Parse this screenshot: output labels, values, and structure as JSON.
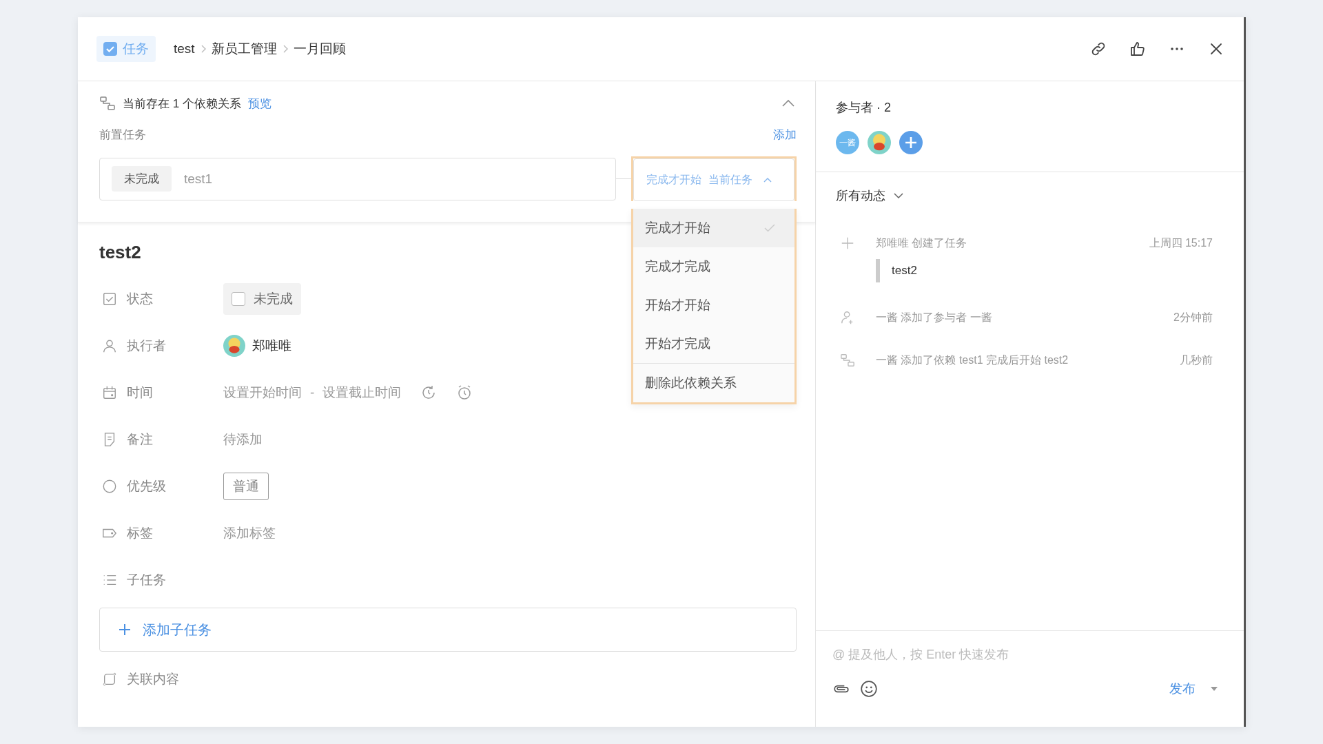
{
  "header": {
    "type_badge": {
      "label": "任务",
      "checked": true
    },
    "breadcrumb": [
      "test",
      "新员工管理",
      "一月回顾"
    ]
  },
  "dependency": {
    "summary": "当前存在 1 个依赖关系",
    "preview_link": "预览",
    "expanded": true,
    "section_label": "前置任务",
    "add_link": "添加",
    "item": {
      "status": "未完成",
      "task": "test1",
      "relation": "完成才开始",
      "target": "当前任务"
    }
  },
  "dropdown": {
    "options": [
      {
        "label": "完成才开始",
        "selected": true
      },
      {
        "label": "完成才完成",
        "selected": false
      },
      {
        "label": "开始才开始",
        "selected": false
      },
      {
        "label": "开始才完成",
        "selected": false
      }
    ],
    "delete_label": "删除此依赖关系"
  },
  "task": {
    "title": "test2",
    "fields": [
      {
        "kind": "status",
        "label": "状态",
        "value": "未完成",
        "checked": false
      },
      {
        "kind": "assignee",
        "label": "执行者",
        "value": "郑唯唯"
      },
      {
        "kind": "time",
        "label": "时间",
        "start": "设置开始时间",
        "separator": "-",
        "end": "设置截止时间"
      },
      {
        "kind": "note",
        "label": "备注",
        "value": "待添加"
      },
      {
        "kind": "priority",
        "label": "优先级",
        "value": "普通"
      },
      {
        "kind": "tags",
        "label": "标签",
        "value": "添加标签"
      },
      {
        "kind": "subtasks",
        "label": "子任务"
      }
    ],
    "add_subtask": "添加子任务",
    "related_label": "关联内容"
  },
  "participants": {
    "title": "参与者 · 2",
    "avatars": [
      {
        "kind": "initials",
        "text": "一酱"
      },
      {
        "kind": "picture"
      }
    ]
  },
  "activity": {
    "filter": "所有动态",
    "items": [
      {
        "kind": "create",
        "text": "郑唯唯 创建了任务",
        "time": "上周四 15:17",
        "quote": "test2"
      },
      {
        "kind": "participant",
        "text": "一酱 添加了参与者 一酱",
        "time": "2分钟前"
      },
      {
        "kind": "dependency",
        "text": "一酱 添加了依赖 test1 完成后开始 test2",
        "time": "几秒前"
      }
    ]
  },
  "composer": {
    "placeholder": "@ 提及他人，按 Enter 快速发布",
    "publish": "发布"
  }
}
